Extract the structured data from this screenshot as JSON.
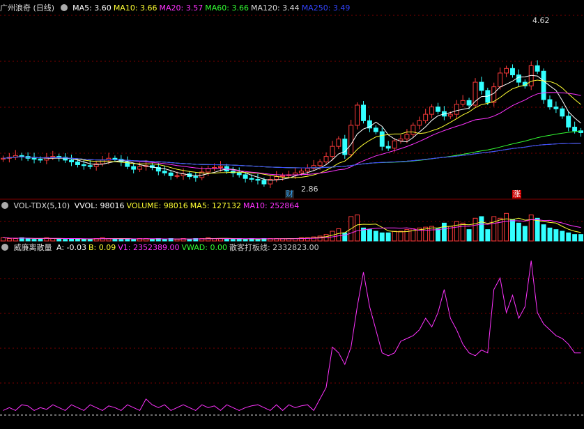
{
  "main_panel": {
    "title": "广州浪奇 (日线)",
    "indicators": [
      {
        "label": "MA5: 3.60",
        "color": "#ffffff"
      },
      {
        "label": "MA10: 3.66",
        "color": "#ffff33"
      },
      {
        "label": "MA20: 3.57",
        "color": "#ff33ff"
      },
      {
        "label": "MA60: 3.66",
        "color": "#33ff33"
      },
      {
        "label": "MA120: 3.44",
        "color": "#dddddd"
      },
      {
        "label": "MA250: 3.49",
        "color": "#3344ff"
      }
    ],
    "high_label": "4.62",
    "low_label": "2.86",
    "marker_cai": "财",
    "marker_zhang": "涨"
  },
  "volume_panel": {
    "title": "VOL-TDX(5,10)",
    "indicators": [
      {
        "label": "VVOL: 98016",
        "color": "#ffffff"
      },
      {
        "label": "VOLUME: 98016",
        "color": "#ffff33"
      },
      {
        "label": "MA5: 127132",
        "color": "#ffff33"
      },
      {
        "label": "MA10: 252864",
        "color": "#ff33ff"
      }
    ]
  },
  "indicator_panel": {
    "title": "威廉离散量",
    "indicators": [
      {
        "label": "A: -0.03",
        "color": "#ffffff"
      },
      {
        "label": "B: 0.09",
        "color": "#ffff33"
      },
      {
        "label": "V1: 2352389.00",
        "color": "#ff33ff"
      },
      {
        "label": "VWAD: 0.00",
        "color": "#33ff33"
      },
      {
        "label": "散客打板线: 2332823.00",
        "color": "#cccccc"
      }
    ]
  },
  "colors": {
    "up": "#ff3b3b",
    "down": "#33ffff",
    "grid": "#800000",
    "ma5": "#ffffff",
    "ma10": "#ffff33",
    "ma20": "#ff33ff",
    "ma60": "#33ff33",
    "ma120": "#dddddd",
    "ma250": "#3344ff",
    "v1_line": "#ff33ff"
  },
  "chart_data": {
    "type": "line",
    "series": [
      {
        "name": "close",
        "values": [
          3.14,
          3.15,
          3.17,
          3.16,
          3.14,
          3.13,
          3.12,
          3.15,
          3.16,
          3.15,
          3.12,
          3.1,
          3.07,
          3.06,
          3.05,
          3.08,
          3.12,
          3.14,
          3.13,
          3.1,
          3.05,
          3.02,
          3.05,
          3.06,
          3.04,
          3.0,
          2.98,
          2.95,
          2.95,
          2.97,
          2.94,
          2.93,
          2.99,
          3.03,
          3.04,
          3.05,
          3.0,
          2.98,
          2.96,
          2.92,
          2.91,
          2.9,
          2.86,
          2.91,
          2.94,
          2.95,
          2.96,
          2.98,
          3.0,
          3.03,
          3.06,
          3.1,
          3.16,
          3.27,
          3.35,
          3.18,
          3.5,
          3.72,
          3.55,
          3.47,
          3.43,
          3.27,
          3.25,
          3.33,
          3.35,
          3.4,
          3.5,
          3.55,
          3.62,
          3.7,
          3.65,
          3.6,
          3.62,
          3.73,
          3.77,
          3.72,
          3.97,
          3.88,
          3.75,
          3.92,
          4.07,
          4.12,
          4.05,
          3.97,
          3.93,
          4.15,
          4.09,
          3.78,
          3.7,
          3.68,
          3.6,
          3.48,
          3.44,
          3.42
        ]
      },
      {
        "name": "VOLUME",
        "values": [
          4,
          3,
          3,
          4,
          3,
          2,
          3,
          4,
          3,
          3,
          2,
          3,
          3,
          2,
          2,
          3,
          4,
          3,
          3,
          2,
          3,
          2,
          3,
          3,
          2,
          3,
          2,
          3,
          2,
          3,
          2,
          3,
          3,
          4,
          3,
          3,
          3,
          2,
          3,
          2,
          3,
          2,
          3,
          3,
          3,
          3,
          3,
          3,
          4,
          4,
          5,
          6,
          8,
          12,
          15,
          10,
          30,
          32,
          16,
          14,
          12,
          10,
          10,
          12,
          12,
          14,
          15,
          16,
          17,
          18,
          15,
          22,
          18,
          24,
          22,
          14,
          28,
          30,
          14,
          30,
          28,
          34,
          26,
          22,
          18,
          32,
          28,
          20,
          16,
          14,
          12,
          10,
          8,
          8
        ]
      },
      {
        "name": "V1",
        "values": [
          2.2,
          2.25,
          2.2,
          2.3,
          2.28,
          2.2,
          2.25,
          2.22,
          2.3,
          2.25,
          2.2,
          2.3,
          2.25,
          2.2,
          2.3,
          2.25,
          2.2,
          2.28,
          2.25,
          2.2,
          2.3,
          2.25,
          2.2,
          2.4,
          2.3,
          2.25,
          2.3,
          2.2,
          2.25,
          2.3,
          2.25,
          2.2,
          2.3,
          2.25,
          2.28,
          2.2,
          2.3,
          2.25,
          2.2,
          2.25,
          2.28,
          2.3,
          2.25,
          2.2,
          2.3,
          2.2,
          2.3,
          2.25,
          2.28,
          2.3,
          2.2,
          2.4,
          2.6,
          3.3,
          3.2,
          3.0,
          3.3,
          4.0,
          4.6,
          4.0,
          3.6,
          3.2,
          3.15,
          3.2,
          3.4,
          3.45,
          3.5,
          3.6,
          3.8,
          3.65,
          3.9,
          4.3,
          3.8,
          3.6,
          3.35,
          3.2,
          3.15,
          3.25,
          3.2,
          4.3,
          4.5,
          3.9,
          4.2,
          3.8,
          4.0,
          4.8,
          3.9,
          3.7,
          3.6,
          3.5,
          3.45,
          3.35,
          3.2,
          3.2
        ]
      }
    ]
  }
}
